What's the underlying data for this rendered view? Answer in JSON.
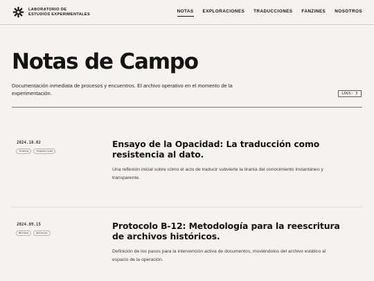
{
  "header": {
    "logo_line1": "LABORATORIO DE",
    "logo_line2": "ESTUDIOS EXPERIMENTALES",
    "nav": [
      {
        "label": "NOTAS",
        "active": true
      },
      {
        "label": "EXPLORACIONES",
        "active": false
      },
      {
        "label": "TRADUCCIONES",
        "active": false
      },
      {
        "label": "FANZINES",
        "active": false
      },
      {
        "label": "NOSOTROS",
        "active": false
      }
    ]
  },
  "hero": {
    "title": "Notas de Campo",
    "description": "Documentación inmediata de procesos y encuentros. El archivo operativo en el momento de la experimentación.",
    "badge": "LOGS: 3"
  },
  "entries": [
    {
      "date": "2024.10.02",
      "tags": [
        "TEORÍA",
        "TRADUCCIÓN"
      ],
      "title": "Ensayo de la Opacidad: La traducción como resistencia al dato.",
      "description": "Una reflexión inicial sobre cómo el acto de traducir subvierte la tiranía del conocimiento instantáneo y transparente."
    },
    {
      "date": "2024.09.15",
      "tags": [
        "MÉTODO",
        "ARCHIVO"
      ],
      "title": "Protocolo B-12: Metodología para la reescritura de archivos históricos.",
      "description": "Definición de los pasos para la intervención activa de documentos, moviéndolos del archivo estático al espacio de la operación."
    }
  ],
  "colors": {
    "background": "#f4f3ef",
    "text": "#141414",
    "rule": "#7a7a7a"
  }
}
